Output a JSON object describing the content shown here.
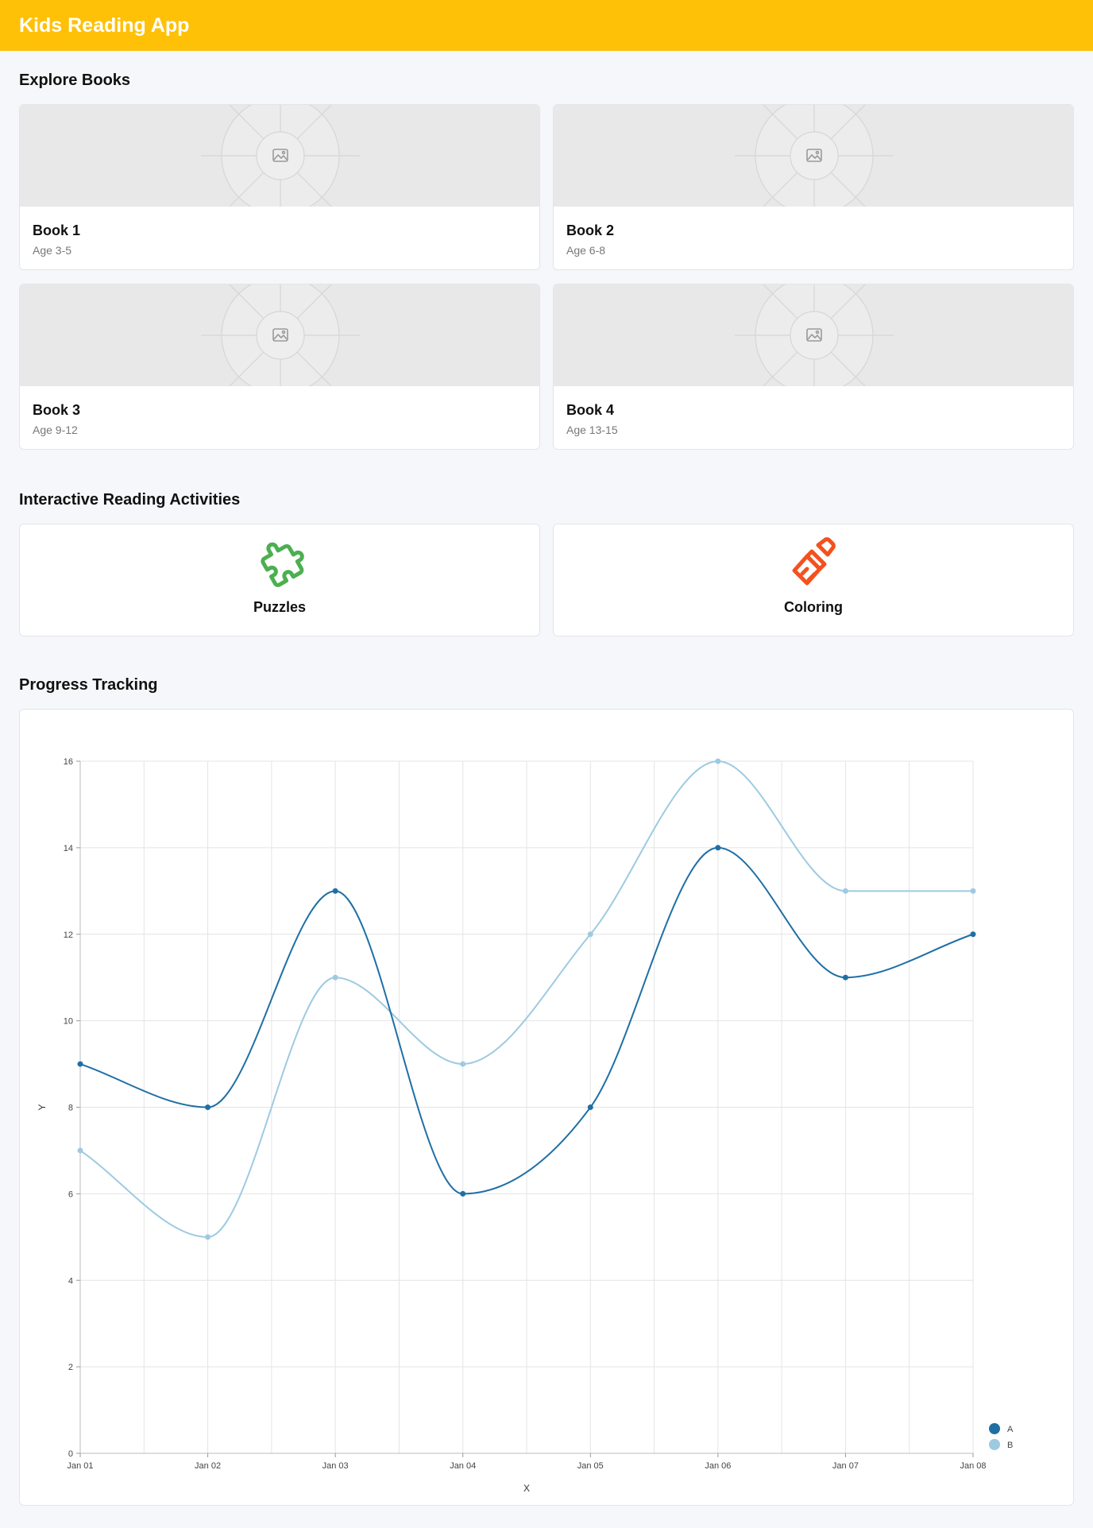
{
  "header": {
    "title": "Kids Reading App"
  },
  "explore": {
    "title": "Explore Books",
    "books": [
      {
        "title": "Book 1",
        "age": "Age 3-5"
      },
      {
        "title": "Book 2",
        "age": "Age 6-8"
      },
      {
        "title": "Book 3",
        "age": "Age 9-12"
      },
      {
        "title": "Book 4",
        "age": "Age 13-15"
      }
    ]
  },
  "activities": {
    "title": "Interactive Reading Activities",
    "items": [
      {
        "label": "Puzzles",
        "icon": "puzzle-icon",
        "color": "#4caf50"
      },
      {
        "label": "Coloring",
        "icon": "paintbrush-icon",
        "color": "#f4511e"
      }
    ]
  },
  "progress": {
    "title": "Progress Tracking"
  },
  "chart_data": {
    "type": "line",
    "title": "",
    "xlabel": "X",
    "ylabel": "Y",
    "categories": [
      "Jan 01",
      "Jan 02",
      "Jan 03",
      "Jan 04",
      "Jan 05",
      "Jan 06",
      "Jan 07",
      "Jan 08"
    ],
    "ylim": [
      0,
      16
    ],
    "yticks": [
      0,
      2,
      4,
      6,
      8,
      10,
      12,
      14,
      16
    ],
    "grid": true,
    "legend_position": "bottom-right",
    "series": [
      {
        "name": "A",
        "color": "#1f6fa5",
        "values": [
          9,
          8,
          13,
          6,
          8,
          14,
          11,
          12
        ]
      },
      {
        "name": "B",
        "color": "#9ecae1",
        "values": [
          7,
          5,
          11,
          9,
          12,
          16,
          13,
          13
        ]
      }
    ]
  }
}
